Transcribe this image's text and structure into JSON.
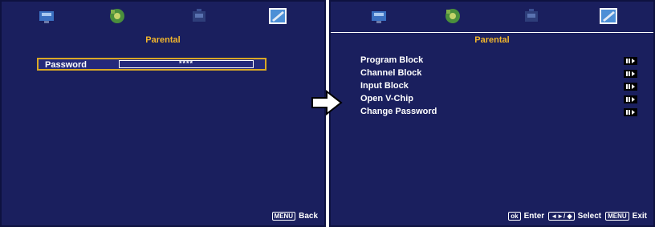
{
  "left": {
    "title": "Parental",
    "password_label": "Password",
    "password_value": "****",
    "footer_key": "MENU",
    "footer_action": "Back"
  },
  "right": {
    "title": "Parental",
    "menu_items": [
      "Program Block",
      "Channel Block",
      "Input Block",
      "Open V-Chip",
      "Change Password"
    ],
    "footer": {
      "ok_key": "ok",
      "enter_label": "Enter",
      "nav_key": "◄►/ ◆",
      "select_label": "Select",
      "menu_key": "MENU",
      "exit_label": "Exit"
    }
  },
  "tab_icons": [
    "picture-icon",
    "sound-icon",
    "setup-icon",
    "parental-icon"
  ],
  "colors": {
    "background": "#1a1f5e",
    "title": "#f0b52d",
    "highlight_border": "#d9a825"
  }
}
